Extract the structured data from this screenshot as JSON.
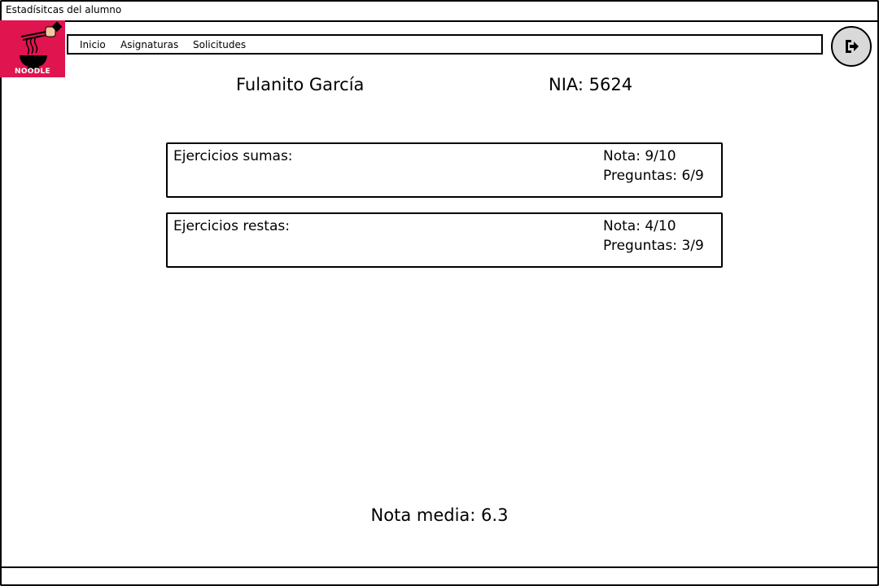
{
  "window": {
    "title": "Estadísitcas del alumno"
  },
  "logo": {
    "text": "NOODLE",
    "brand_color": "#e0144f"
  },
  "nav": {
    "items": [
      {
        "label": "Inicio"
      },
      {
        "label": "Asignaturas"
      },
      {
        "label": "Solicitudes"
      }
    ]
  },
  "logout": {
    "icon": "sign-out-icon"
  },
  "student": {
    "name": "Fulanito García",
    "nia": "NIA: 5624"
  },
  "exercises": [
    {
      "title": "Ejercicios sumas:",
      "grade": "Nota: 9/10",
      "questions": "Preguntas: 6/9"
    },
    {
      "title": "Ejercicios restas:",
      "grade": "Nota: 4/10",
      "questions": "Preguntas: 3/9"
    }
  ],
  "average": "Nota media: 6.3"
}
